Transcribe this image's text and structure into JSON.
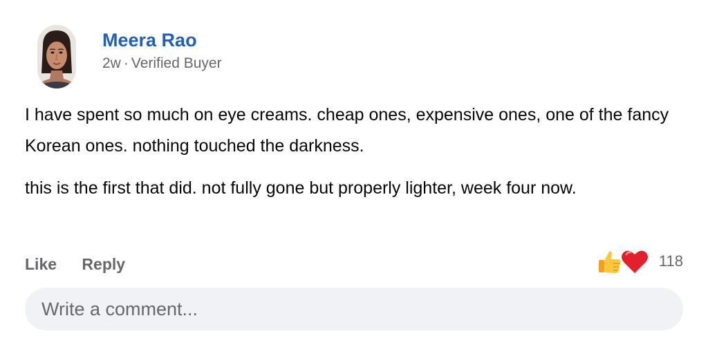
{
  "post": {
    "author_name": "Meera Rao",
    "age": "2w",
    "separator": "·",
    "badge": "Verified Buyer",
    "paragraphs": [
      "I have spent so much on eye creams. cheap ones, expensive ones, one of the fancy Korean ones. nothing touched the darkness.",
      "this is the first that did. not fully gone but properly lighter, week four now."
    ]
  },
  "actions": {
    "like_label": "Like",
    "reply_label": "Reply"
  },
  "reactions": {
    "icons": [
      "thumbs-up-icon",
      "heart-icon"
    ],
    "count": "118"
  },
  "composer": {
    "placeholder": "Write a comment..."
  },
  "colors": {
    "author": "#1f5fbf",
    "secondary_text": "#65676b",
    "input_background": "#f0f2f5"
  }
}
